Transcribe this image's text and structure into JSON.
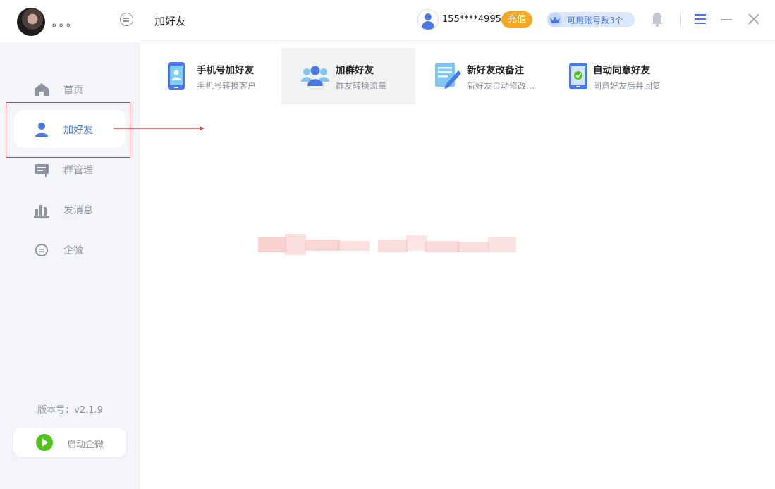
{
  "sidebar": {
    "user_name": "。。。",
    "items": [
      {
        "label": "首页",
        "icon": "home-icon"
      },
      {
        "label": "加好友",
        "icon": "user-icon"
      },
      {
        "label": "群管理",
        "icon": "group-manage-icon"
      },
      {
        "label": "发消息",
        "icon": "send-message-icon"
      },
      {
        "label": "企微",
        "icon": "chat-bubble-icon"
      }
    ],
    "active_index": 1,
    "version": "版本号：v2.1.9",
    "start_label": "启动企微"
  },
  "header": {
    "title": "加好友",
    "phone": "155****4995",
    "recharge_label": "充值",
    "accounts_label": "可用账号数3个"
  },
  "cards": [
    {
      "title": "手机号加好友",
      "subtitle": "手机号转换客户",
      "icon": "phone-icon"
    },
    {
      "title": "加群好友",
      "subtitle": "群友转换流量",
      "icon": "group-users-icon"
    },
    {
      "title": "新好友改备注",
      "subtitle": "新好友自动修改…",
      "icon": "edit-note-icon"
    },
    {
      "title": "自动同意好友",
      "subtitle": "同意好友后并回复",
      "icon": "auto-accept-icon"
    }
  ],
  "colors": {
    "accent": "#4a78e8",
    "recharge": "#f5a623",
    "annotation": "#e23535",
    "start": "#52c41a"
  }
}
